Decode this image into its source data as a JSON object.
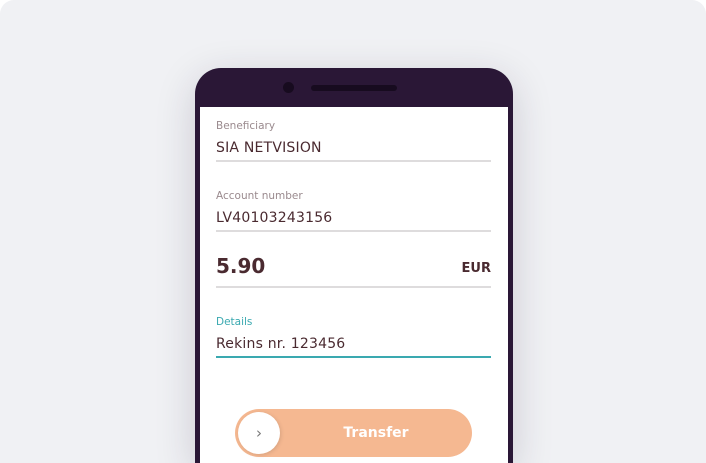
{
  "form": {
    "beneficiary": {
      "label": "Beneficiary",
      "value": "SIA NETVISION"
    },
    "account": {
      "label": "Account number",
      "value": "LV40103243156"
    },
    "amount": {
      "value": "5.90",
      "currency": "EUR"
    },
    "details": {
      "label": "Details",
      "value": "Rekins nr. 123456"
    }
  },
  "transfer_button": {
    "label": "Transfer",
    "icon": "chevron-right-icon"
  },
  "colors": {
    "accent": "#3aa9b0",
    "button": "#f5b891",
    "frame": "#2a1736"
  }
}
